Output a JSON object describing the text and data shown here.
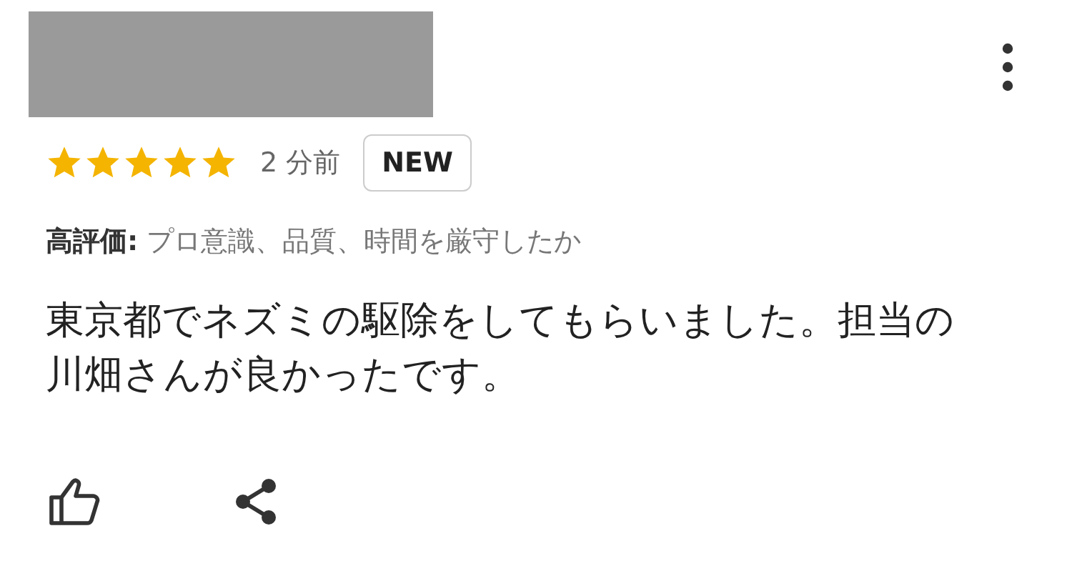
{
  "review": {
    "stars": 5,
    "time": "2 分前",
    "badge": "NEW",
    "rating_line": "**高評価:** プロ意識、品質、時間を厳守したか",
    "text": "東京都でネズミの駆除をしてもらいました。担当の川畑さんが良かったです。"
  }
}
